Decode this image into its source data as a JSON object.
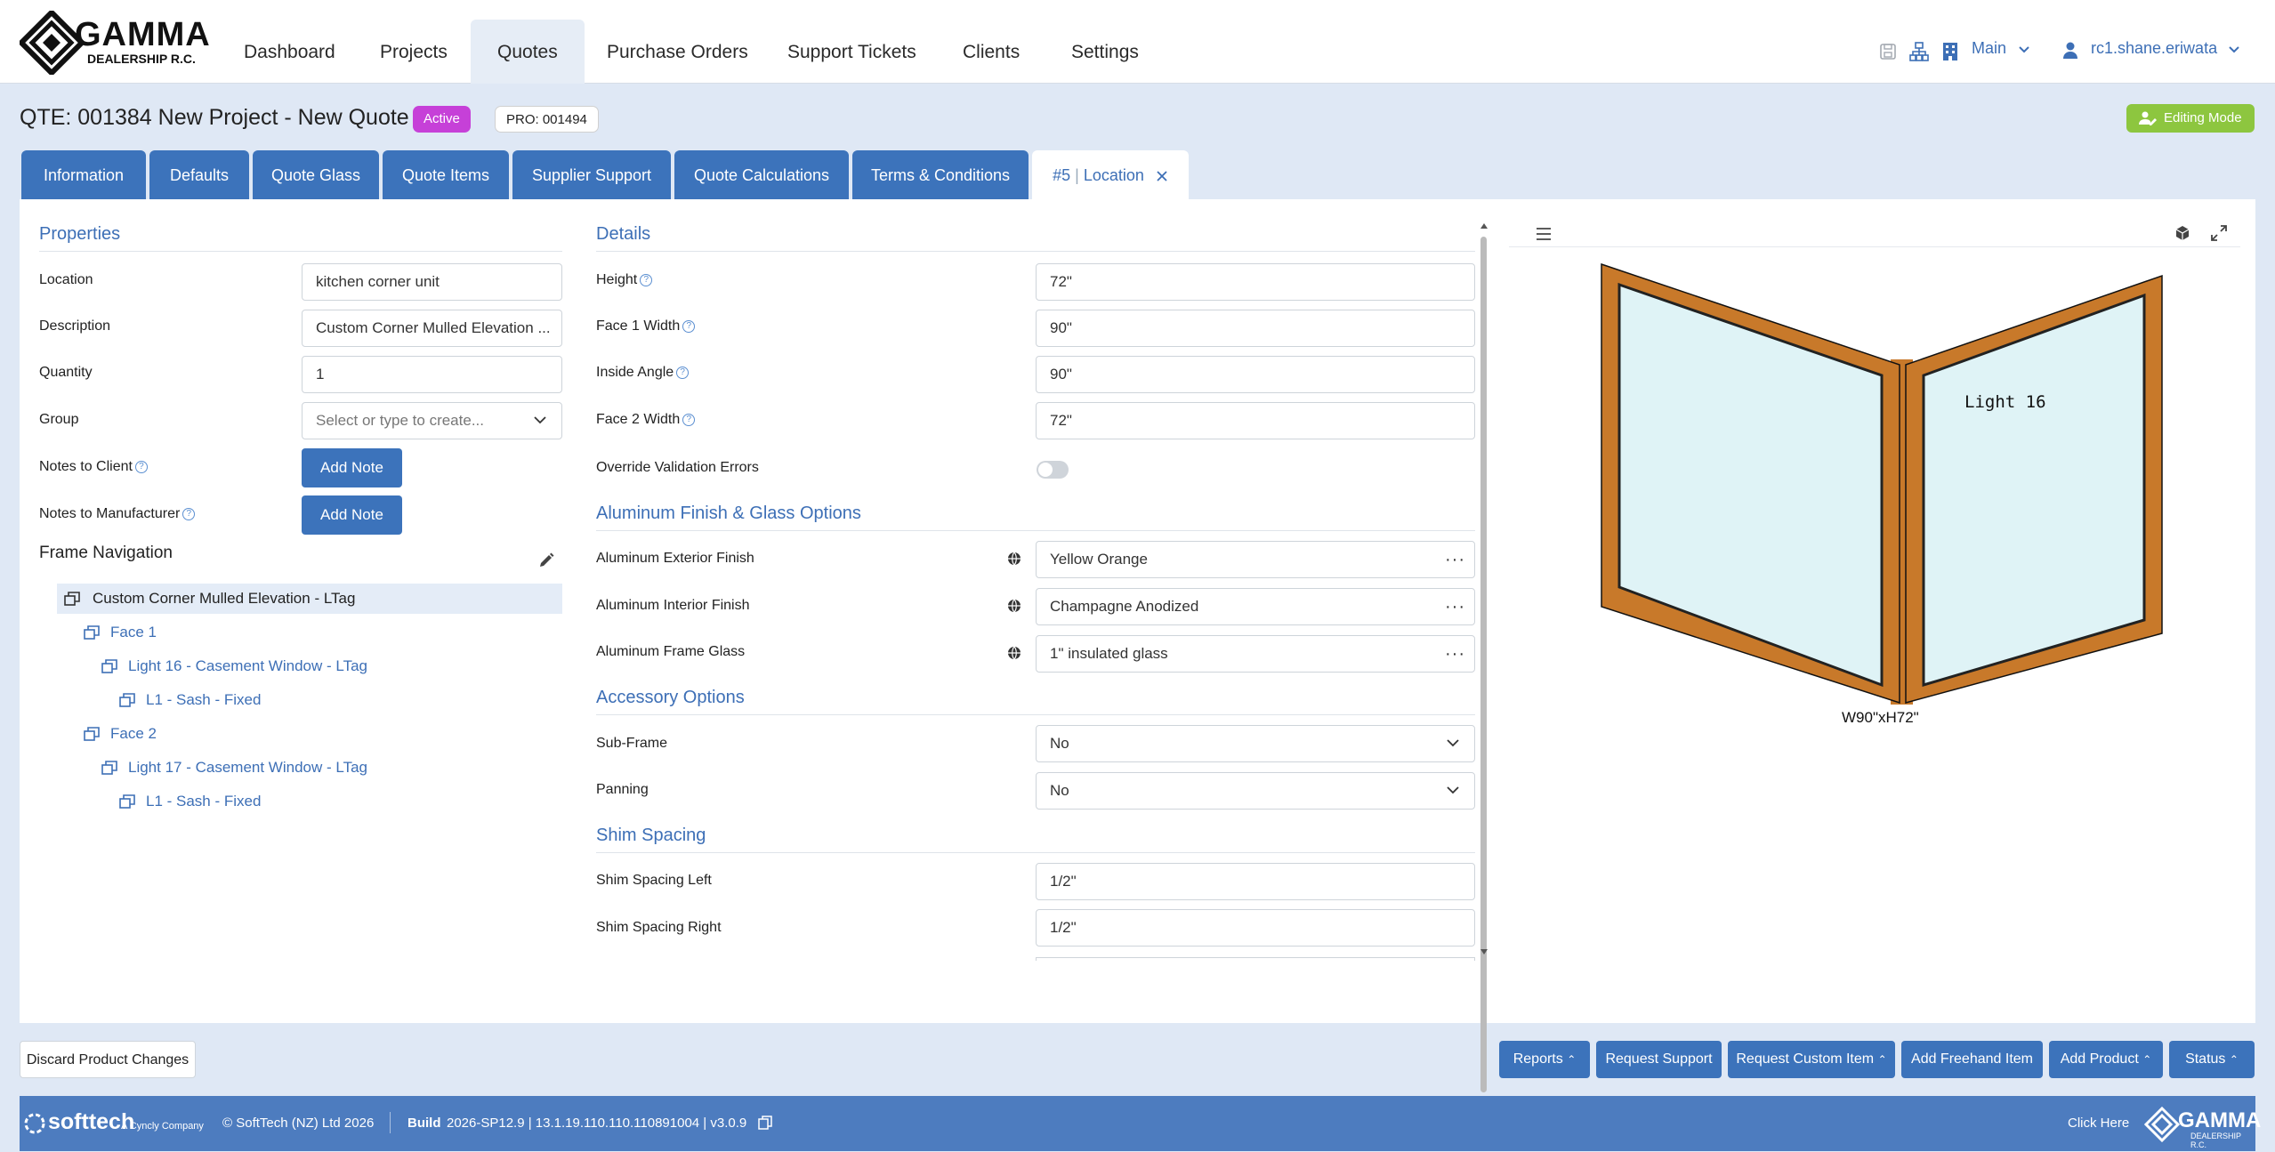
{
  "brand": {
    "name": "GAMMA",
    "sub": "DEALERSHIP R.C."
  },
  "nav": [
    "Dashboard",
    "Projects",
    "Quotes",
    "Purchase Orders",
    "Support Tickets",
    "Clients",
    "Settings"
  ],
  "topright": {
    "branch": "Main",
    "user": "rc1.shane.eriwata"
  },
  "quote": {
    "title": "QTE: 001384 New Project - New Quote",
    "status": "Active",
    "pro": "PRO: 001494",
    "mode": "Editing Mode"
  },
  "tabs": [
    "Information",
    "Defaults",
    "Quote Glass",
    "Quote Items",
    "Supplier Support",
    "Quote Calculations",
    "Terms & Conditions"
  ],
  "active_tab": {
    "num": "#5",
    "sep": "|",
    "label": "Location"
  },
  "properties": {
    "title": "Properties",
    "location_label": "Location",
    "location_value": "kitchen corner unit",
    "description_label": "Description",
    "description_value": "Custom Corner Mulled Elevation ...",
    "quantity_label": "Quantity",
    "quantity_value": "1",
    "group_label": "Group",
    "group_placeholder": "Select or type to create...",
    "notes_client_label": "Notes to Client",
    "notes_mfr_label": "Notes to Manufacturer",
    "add_note": "Add Note"
  },
  "frame_nav": {
    "title": "Frame Navigation",
    "items": [
      "Custom Corner Mulled Elevation - LTag",
      "Face 1",
      "Light 16 - Casement Window - LTag",
      "L1 - Sash - Fixed",
      "Face 2",
      "Light 17 - Casement Window - LTag",
      "L1 - Sash - Fixed"
    ]
  },
  "details": {
    "title": "Details",
    "height_label": "Height",
    "height_value": "72\"",
    "face1_label": "Face 1 Width",
    "face1_value": "90\"",
    "angle_label": "Inside Angle",
    "angle_value": "90\"",
    "face2_label": "Face 2 Width",
    "face2_value": "72\"",
    "override_label": "Override Validation Errors",
    "override_on": false
  },
  "finish": {
    "title": "Aluminum Finish & Glass Options",
    "ext_label": "Aluminum Exterior Finish",
    "ext_value": "Yellow Orange",
    "int_label": "Aluminum Interior Finish",
    "int_value": "Champagne Anodized",
    "glass_label": "Aluminum Frame Glass",
    "glass_value": "1\" insulated glass"
  },
  "accessory": {
    "title": "Accessory Options",
    "subframe_label": "Sub-Frame",
    "subframe_value": "No",
    "panning_label": "Panning",
    "panning_value": "No"
  },
  "shim": {
    "title": "Shim Spacing",
    "left_label": "Shim Spacing Left",
    "left_value": "1/2\"",
    "right_label": "Shim Spacing Right",
    "right_value": "1/2\""
  },
  "preview": {
    "light_label": "Light 16",
    "dim_label": "W90\"xH72\"",
    "frame_color": "#c8792a",
    "glass_color": "#dff3f6"
  },
  "actions": {
    "discard": "Discard Product Changes",
    "reports": "Reports",
    "support": "Request Support",
    "custom": "Request Custom Item",
    "freehand": "Add Freehand Item",
    "add_product": "Add Product",
    "status": "Status"
  },
  "footer": {
    "softtech": "softtech",
    "cyncly": "A Cyncly Company",
    "copyright": "© SoftTech (NZ) Ltd 2026",
    "build_label": "Build",
    "build_value": "2026-SP12.9 | 13.1.19.110.110.110891004 | v3.0.9",
    "click_here": "Click Here"
  }
}
